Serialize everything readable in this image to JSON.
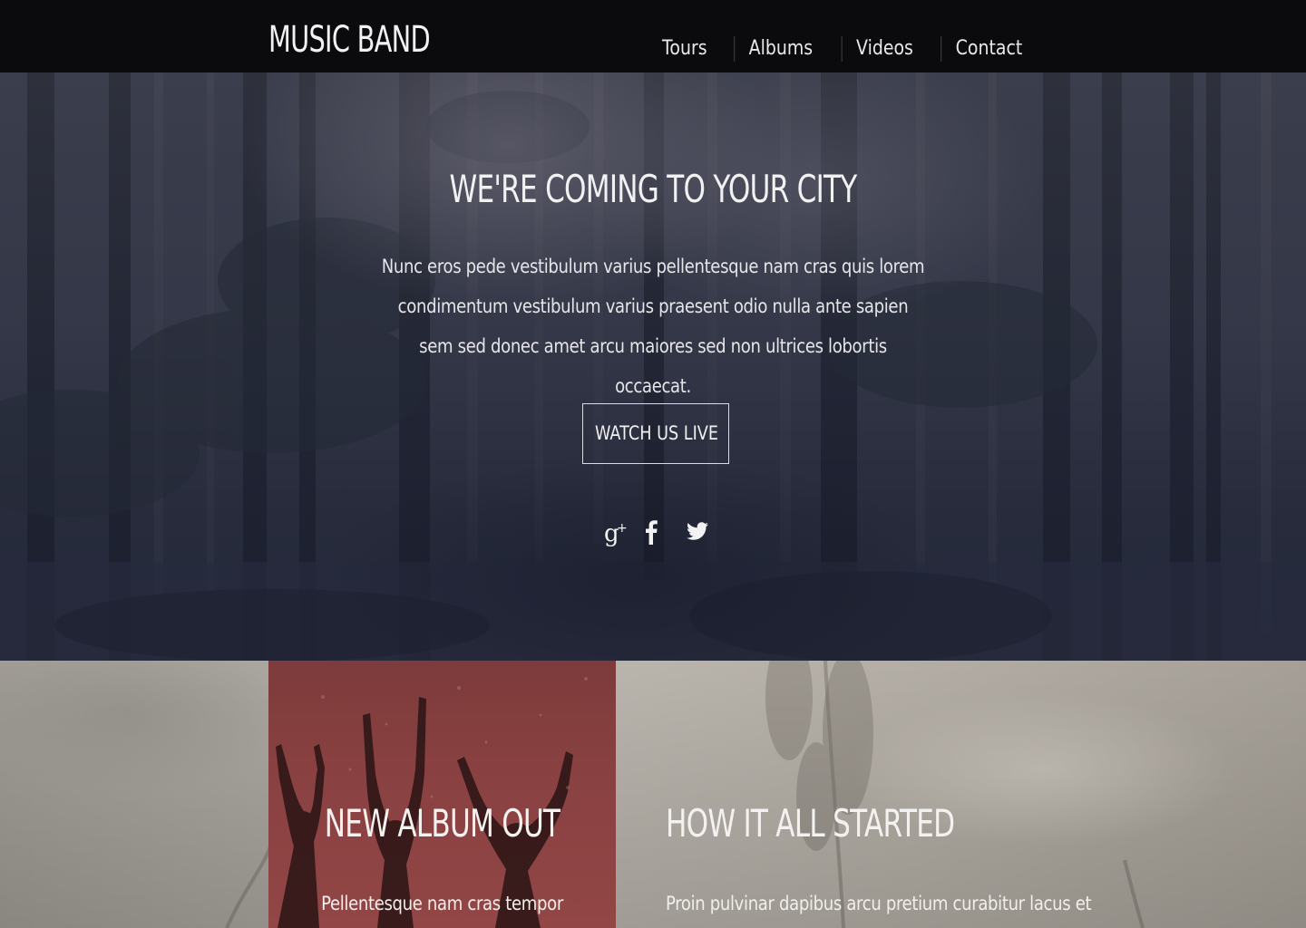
{
  "header": {
    "brand": "MUSIC BAND",
    "nav": [
      {
        "label": "Tours"
      },
      {
        "label": "Albums"
      },
      {
        "label": "Videos"
      },
      {
        "label": "Contact"
      }
    ]
  },
  "hero": {
    "title": "WE'RE COMING TO YOUR CITY",
    "text": "Nunc eros pede vestibulum varius pellentesque nam cras quis lorem condimentum vestibulum varius praesent odio nulla ante sapien sem sed donec amet arcu maiores sed non ultrices lobortis occaecat.",
    "button_label": "WATCH US LIVE",
    "social": [
      {
        "icon": "google-plus-icon"
      },
      {
        "icon": "facebook-icon"
      },
      {
        "icon": "twitter-icon"
      }
    ]
  },
  "album": {
    "title": "NEW ALBUM OUT",
    "text": "Pellentesque nam cras tempor"
  },
  "story": {
    "title": "HOW IT ALL STARTED",
    "text": "Proin pulvinar dapibus arcu pretium curabitur lacus et"
  },
  "colors": {
    "header_bg": "#0b0b0d",
    "hero_tint": "#2a2e40",
    "album_card": "#8a4141",
    "lower_bg": "#b8b3ab",
    "text": "#f1f1f1"
  }
}
